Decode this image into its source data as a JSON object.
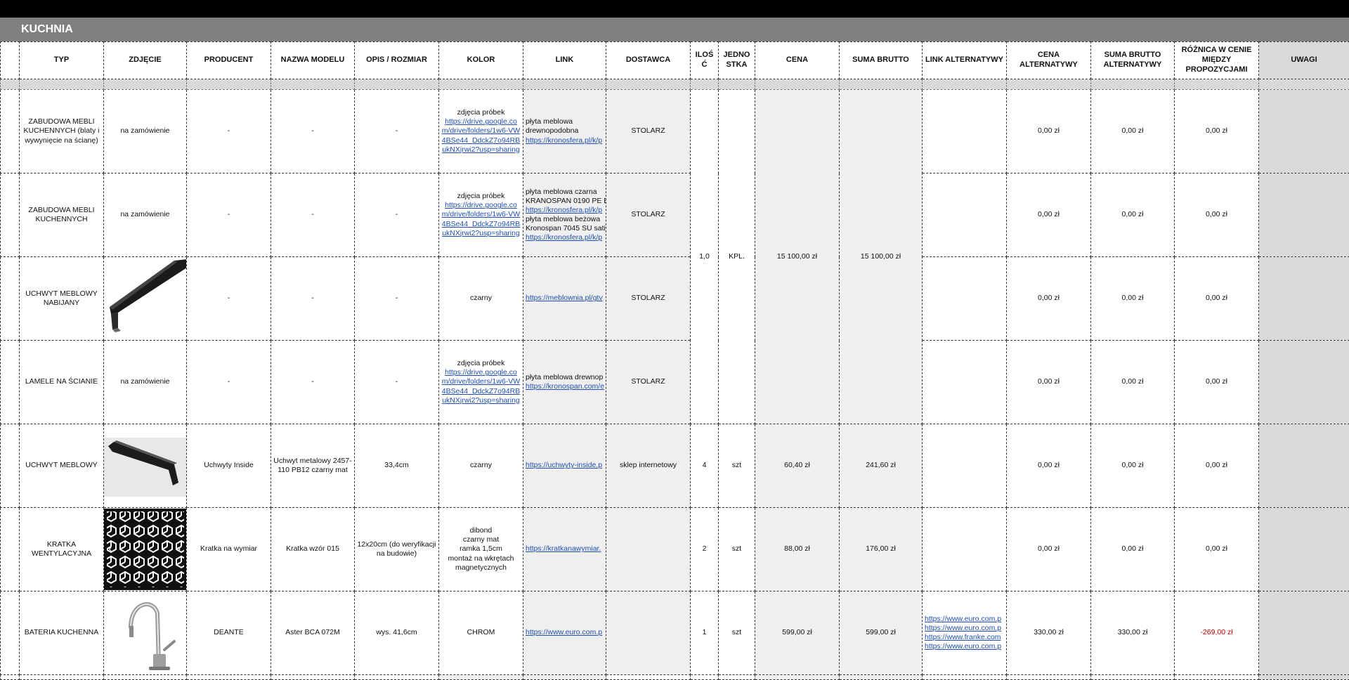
{
  "sheet": {
    "section_title": "KUCHNIA",
    "headers": {
      "typ": "TYP",
      "zdjecie": "ZDJĘCIE",
      "producent": "PRODUCENT",
      "nazwa": "NAZWA MODELU",
      "opis": "OPIS / ROZMIAR",
      "kolor": "KOLOR",
      "link": "LINK",
      "dostawca": "DOSTAWCA",
      "ilosc": "ILOŚĆ",
      "jednostka": "JEDNOSTKA",
      "cena": "CENA",
      "suma": "SUMA BRUTTO",
      "link_alt": "LINK ALTERNATYWY",
      "cena_alt": "CENA ALTERNATYWY",
      "suma_alt": "SUMA BRUTTO ALTERNATYWY",
      "roznica": "RÓŻNICA W CENIE MIĘDZY PROPOZYCJAMI",
      "uwagi": "UWAGI"
    },
    "merged_group": {
      "ilosc": "1,0",
      "jednostka": "KPL.",
      "cena": "15 100,00 zł",
      "suma": "15 100,00 zł"
    },
    "rows": [
      {
        "typ": "ZABUDOWA MEBLI KUCHENNYCH (blaty i wywynięcie na ścianę)",
        "zdjecie": "na zamówienie",
        "producent": "-",
        "nazwa": "-",
        "opis": "-",
        "kolor_text": "zdjęcia próbek",
        "kolor_link": "https://drive.google.com/drive/folders/1w6-VW4BSe44_DdckZ7o94RBukNXjrwi2?usp=sharing",
        "link_text1": "płyta meblowa",
        "link_text2": "drewnopodobna",
        "link_url": "https://kronosfera.pl/k/p",
        "dostawca": "STOLARZ",
        "cena_alt": "0,00 zł",
        "suma_alt": "0,00 zł",
        "roznica": "0,00 zł"
      },
      {
        "typ": "ZABUDOWA MEBLI KUCHENNYCH",
        "zdjecie": "na zamówienie",
        "producent": "-",
        "nazwa": "-",
        "opis": "-",
        "kolor_text": "zdjęcia próbek",
        "kolor_link": "https://drive.google.com/drive/folders/1w6-VW4BSe44_DdckZ7o94RBukNXjrwi2?usp=sharing",
        "link_text1": "płyta meblowa czarna",
        "link_text2": "KRANOSPAN 0190 PE E",
        "link_url": "https://kronosfera.pl/k/p",
        "link_text3": "płyta meblowa beżowa",
        "link_text4": "Kronospan 7045 SU sati",
        "link_url2": "https://kronosfera.pl/k/p",
        "dostawca": "STOLARZ",
        "cena_alt": "0,00 zł",
        "suma_alt": "0,00 zł",
        "roznica": "0,00 zł"
      },
      {
        "typ": "UCHWYT MEBLOWY NABIJANY",
        "producent": "-",
        "nazwa": "-",
        "opis": "-",
        "kolor": "czarny",
        "link_url": "https://meblownia.pl/gtv",
        "dostawca": "STOLARZ",
        "cena_alt": "0,00 zł",
        "suma_alt": "0,00 zł",
        "roznica": "0,00 zł"
      },
      {
        "typ": "LAMELE NA ŚCIANIE",
        "zdjecie": "na zamówienie",
        "producent": "-",
        "nazwa": "-",
        "opis": "-",
        "kolor_text": "zdjęcia próbek",
        "kolor_link": "https://drive.google.com/drive/folders/1w6-VW4BSe44_DdckZ7o94RBukNXjrwi2?usp=sharing",
        "link_text1": "płyta meblowa drewnop",
        "link_url": "https://kronospan.com/e",
        "dostawca": "STOLARZ",
        "cena_alt": "0,00 zł",
        "suma_alt": "0,00 zł",
        "roznica": "0,00 zł"
      },
      {
        "typ": "UCHWYT MEBLOWY",
        "producent": "Uchwyty Inside",
        "nazwa": "Uchwyt metalowy 2457-110 PB12 czarny mat",
        "opis": "33,4cm",
        "kolor": "czarny",
        "link_url": "https://uchwyty-inside.p",
        "dostawca": "sklep internetowy",
        "ilosc": "4",
        "jednostka": "szt",
        "cena": "60,40 zł",
        "suma": "241,60 zł",
        "cena_alt": "0,00 zł",
        "suma_alt": "0,00 zł",
        "roznica": "0,00 zł"
      },
      {
        "typ": "KRATKA WENTYLACYJNA",
        "producent": "Kratka na wymiar",
        "nazwa": "Kratka wzór 015",
        "opis": "12x20cm (do weryfikacji na budowie)",
        "kolor_lines": [
          "dibond",
          "czarny mat",
          "ramka 1,5cm",
          "montaż na wkrętach",
          "magnetycznych"
        ],
        "link_url": "https://kratkanawymiar.",
        "ilosc": "2",
        "jednostka": "szt",
        "cena": "88,00 zł",
        "suma": "176,00 zł",
        "cena_alt": "0,00 zł",
        "suma_alt": "0,00 zł",
        "roznica": "0,00 zł"
      },
      {
        "typ": "BATERIA KUCHENNA",
        "producent": "DEANTE",
        "nazwa": "Aster BCA 072M",
        "opis": "wys. 41,6cm",
        "kolor": "CHROM",
        "link_url": "https://www.euro.com.p",
        "ilosc": "1",
        "jednostka": "szt",
        "cena": "599,00 zł",
        "suma": "599,00 zł",
        "link_alt": [
          "https://www.euro.com.p",
          "https://www.euro.com.p",
          "https://www.franke.com",
          "https://www.euro.com.p"
        ],
        "cena_alt": "330,00 zł",
        "suma_alt": "330,00 zł",
        "roznica": "-269,00 zł"
      }
    ]
  }
}
